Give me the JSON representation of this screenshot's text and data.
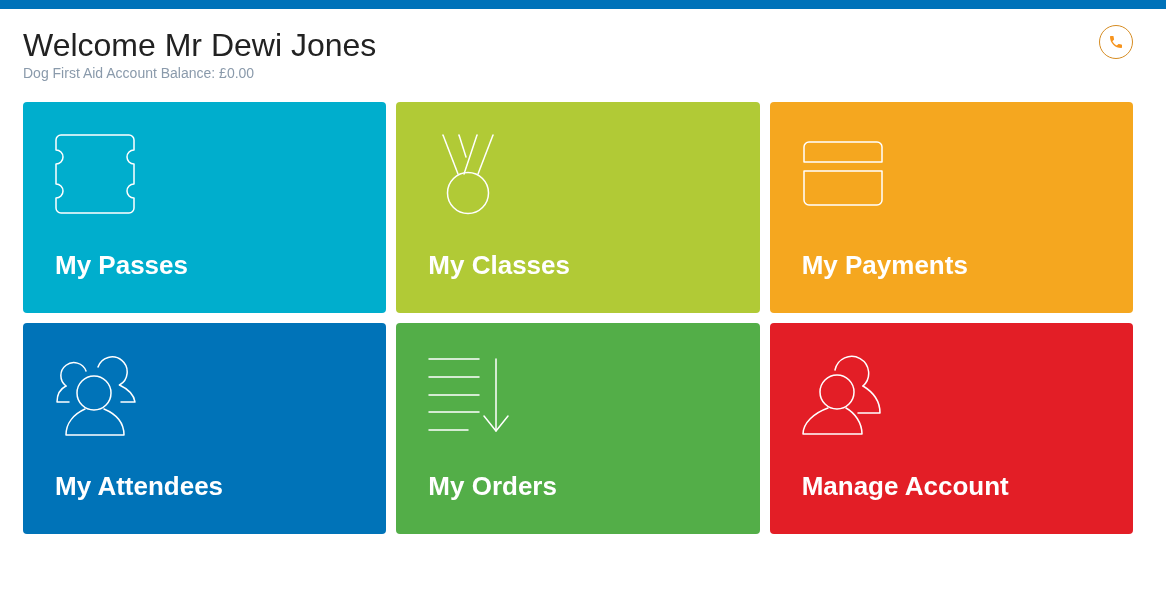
{
  "header": {
    "title": "Welcome Mr Dewi Jones",
    "subtitle": "Dog First Aid Account Balance: £0.00"
  },
  "tiles": [
    {
      "label": "My Passes",
      "color": "#00aecd"
    },
    {
      "label": "My Classes",
      "color": "#b1ca36"
    },
    {
      "label": "My Payments",
      "color": "#f5a71f"
    },
    {
      "label": "My Attendees",
      "color": "#0073b8"
    },
    {
      "label": "My Orders",
      "color": "#53ae48"
    },
    {
      "label": "Manage Account",
      "color": "#e31e26"
    }
  ]
}
